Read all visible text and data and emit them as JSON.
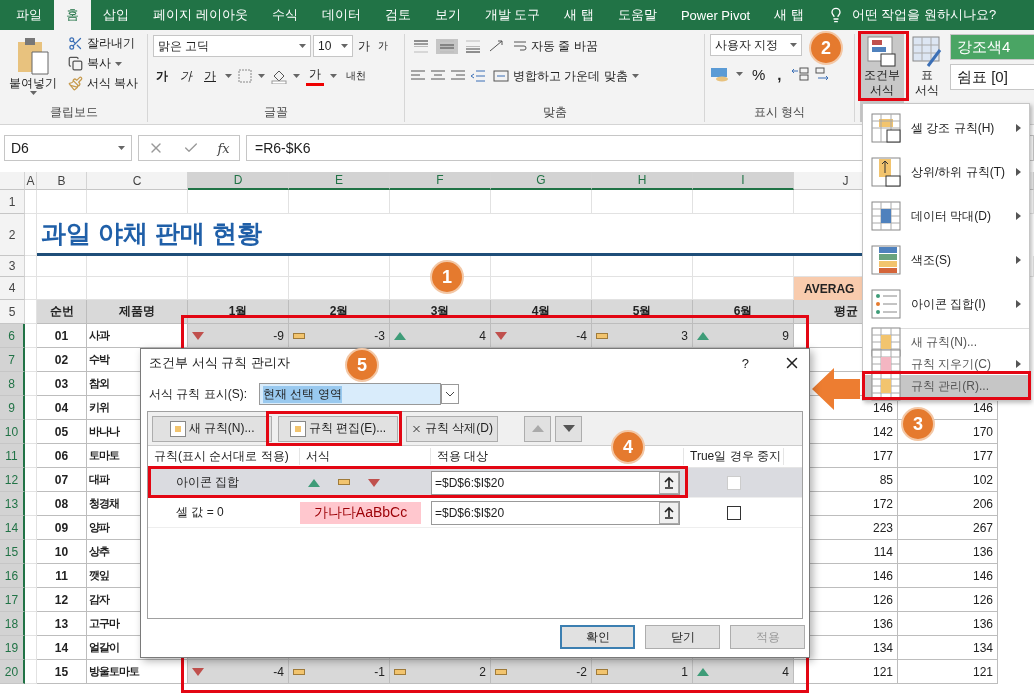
{
  "ribbon_tabs": [
    {
      "label": "파일",
      "selected": false
    },
    {
      "label": "홈",
      "selected": true
    },
    {
      "label": "삽입",
      "selected": false
    },
    {
      "label": "페이지 레이아웃",
      "selected": false
    },
    {
      "label": "수식",
      "selected": false
    },
    {
      "label": "데이터",
      "selected": false
    },
    {
      "label": "검토",
      "selected": false
    },
    {
      "label": "보기",
      "selected": false
    },
    {
      "label": "개발 도구",
      "selected": false
    },
    {
      "label": "새 탭",
      "selected": false
    },
    {
      "label": "도움말",
      "selected": false
    },
    {
      "label": "Power Pivot",
      "selected": false
    },
    {
      "label": "새 탭",
      "selected": false
    }
  ],
  "tell_me": "어떤 작업을 원하시나요?",
  "clipboard": {
    "paste": "붙여넣기",
    "cut": "잘라내기",
    "copy": "복사",
    "format_painter": "서식 복사",
    "group": "클립보드"
  },
  "font": {
    "name": "맑은 고딕",
    "size": "10",
    "grow": "가",
    "shrink": "가",
    "bold": "가",
    "italic": "가",
    "underline": "가",
    "font_color": "가",
    "phonetic": "내천",
    "group": "글꼴"
  },
  "alignment": {
    "vertical_align": [
      {
        "selected": false
      },
      {
        "selected": true
      },
      {
        "selected": false
      }
    ],
    "wrap": "자동 줄 바꿈",
    "merge": "병합하고 가운데 맞춤",
    "group": "맞춤"
  },
  "number": {
    "format": "사용자 지정",
    "percent": "%",
    "comma": ",",
    "group": "표시 형식"
  },
  "styles": {
    "conditional": {
      "lines": [
        "조건부",
        "서식"
      ],
      "pressed": true
    },
    "table": {
      "lines": [
        "표",
        "서식"
      ],
      "pressed": false
    },
    "cell_styles": [
      {
        "label": "강조색4",
        "kind": "accent"
      },
      {
        "label": "쉼표 [0]",
        "kind": "plain"
      }
    ]
  },
  "formula_bar": {
    "name_box": "D6",
    "function_label": "fx",
    "formula": "=R6-$K6"
  },
  "sheet": {
    "columns": [
      {
        "label": "A",
        "selected": false
      },
      {
        "label": "B",
        "selected": false
      },
      {
        "label": "C",
        "selected": false
      },
      {
        "label": "D",
        "selected": true
      },
      {
        "label": "E",
        "selected": true
      },
      {
        "label": "F",
        "selected": true
      },
      {
        "label": "G",
        "selected": true
      },
      {
        "label": "H",
        "selected": true
      },
      {
        "label": "I",
        "selected": true
      },
      {
        "label": "J",
        "selected": false
      }
    ],
    "rows": [
      {
        "number": "1",
        "kind": "blank",
        "selected": false
      },
      {
        "number": "2",
        "kind": "title",
        "selected": false,
        "title": "과일 야채 판매 현황"
      },
      {
        "number": "3",
        "kind": "blank",
        "selected": false
      },
      {
        "number": "4",
        "kind": "average",
        "selected": false,
        "label": "AVERAG"
      },
      {
        "number": "5",
        "kind": "header",
        "selected": false,
        "headers": [
          "순번",
          "제품명",
          "1월",
          "2월",
          "3월",
          "4월",
          "5월",
          "6월",
          "평균"
        ]
      },
      {
        "number": "6",
        "kind": "data",
        "selected": true,
        "id": "01",
        "name": "사과",
        "cells": [
          {
            "kind": "down",
            "value": "-9"
          },
          {
            "kind": "flat",
            "value": "-3"
          },
          {
            "kind": "up",
            "value": "4"
          },
          {
            "kind": "down",
            "value": "-4"
          },
          {
            "kind": "flat",
            "value": "3"
          },
          {
            "kind": "up",
            "value": "9"
          }
        ]
      },
      {
        "number": "7",
        "kind": "data",
        "selected": true,
        "id": "02",
        "name": "수박"
      },
      {
        "number": "8",
        "kind": "data",
        "selected": true,
        "id": "03",
        "name": "참외"
      },
      {
        "number": "9",
        "kind": "data",
        "selected": true,
        "id": "04",
        "name": "키위",
        "average": "146",
        "k": "146"
      },
      {
        "number": "10",
        "kind": "data",
        "selected": true,
        "id": "05",
        "name": "바나나",
        "average": "142",
        "k": "170"
      },
      {
        "number": "11",
        "kind": "data",
        "selected": true,
        "id": "06",
        "name": "토마토",
        "average": "177",
        "k": "177"
      },
      {
        "number": "12",
        "kind": "data",
        "selected": true,
        "id": "07",
        "name": "대파",
        "average": "85",
        "k": "102"
      },
      {
        "number": "13",
        "kind": "data",
        "selected": true,
        "id": "08",
        "name": "청경채",
        "average": "172",
        "k": "206"
      },
      {
        "number": "14",
        "kind": "data",
        "selected": true,
        "id": "09",
        "name": "양파",
        "average": "223",
        "k": "267"
      },
      {
        "number": "15",
        "kind": "data",
        "selected": true,
        "id": "10",
        "name": "상추",
        "average": "114",
        "k": "136"
      },
      {
        "number": "16",
        "kind": "data",
        "selected": true,
        "id": "11",
        "name": "깻잎",
        "average": "146",
        "k": "146"
      },
      {
        "number": "17",
        "kind": "data",
        "selected": true,
        "id": "12",
        "name": "감자",
        "average": "126",
        "k": "126"
      },
      {
        "number": "18",
        "kind": "data",
        "selected": true,
        "id": "13",
        "name": "고구마",
        "average": "136",
        "k": "136"
      },
      {
        "number": "19",
        "kind": "data",
        "selected": true,
        "id": "14",
        "name": "얼갈이",
        "average": "134",
        "k": "134"
      },
      {
        "number": "20",
        "kind": "data",
        "selected": true,
        "id": "15",
        "name": "방울토마토",
        "average": "121",
        "k": "121",
        "cells": [
          {
            "kind": "down",
            "value": "-4"
          },
          {
            "kind": "flat",
            "value": "-1"
          },
          {
            "kind": "flat",
            "value": "2"
          },
          {
            "kind": "flat",
            "value": "-2"
          },
          {
            "kind": "flat",
            "value": "1"
          },
          {
            "kind": "up",
            "value": "4"
          }
        ]
      }
    ]
  },
  "menu": {
    "items": [
      {
        "kind": "large",
        "label": "셀 강조 규칙(H)",
        "submenu": true,
        "selected": false
      },
      {
        "kind": "large",
        "label": "상위/하위 규칙(T)",
        "submenu": true,
        "selected": false
      },
      {
        "kind": "large",
        "label": "데이터 막대(D)",
        "submenu": true,
        "selected": false
      },
      {
        "kind": "large",
        "label": "색조(S)",
        "submenu": true,
        "selected": false
      },
      {
        "kind": "large",
        "label": "아이콘 집합(I)",
        "submenu": true,
        "selected": false
      },
      {
        "kind": "small",
        "label": "새 규칙(N)...",
        "submenu": false,
        "selected": false
      },
      {
        "kind": "small",
        "label": "규칙 지우기(C)",
        "submenu": true,
        "selected": false
      },
      {
        "kind": "small",
        "label": "규칙 관리(R)...",
        "submenu": false,
        "selected": true
      }
    ]
  },
  "dialog": {
    "title": "조건부 서식 규칙 관리자",
    "help": "?",
    "show_label": "서식 규칙 표시(S):",
    "show_value": "현재 선택 영역",
    "toolbar": [
      {
        "label": "새 규칙(N)...",
        "kind": "new"
      },
      {
        "label": "규칙 편집(E)...",
        "kind": "edit"
      },
      {
        "label": "규칙 삭제(D)",
        "kind": "delete"
      }
    ],
    "columns": [
      "규칙(표시 순서대로 적용)",
      "서식",
      "적용 대상",
      "True일 경우 중지"
    ],
    "rules": [
      {
        "name": "아이콘 집합",
        "kind": "icon_set",
        "range": "=$D$6:$I$20",
        "stop_if_true": false,
        "selected": true
      },
      {
        "name": "셀 값 = 0",
        "kind": "preview",
        "preview": "가나다AaBbCc",
        "range": "=$D$6:$I$20",
        "stop_if_true": false,
        "selected": false
      }
    ],
    "buttons": [
      {
        "label": "확인",
        "disabled": false
      },
      {
        "label": "닫기",
        "disabled": false
      },
      {
        "label": "적용",
        "disabled": true
      }
    ]
  },
  "annotations": [
    "1",
    "2",
    "3",
    "4",
    "5"
  ]
}
